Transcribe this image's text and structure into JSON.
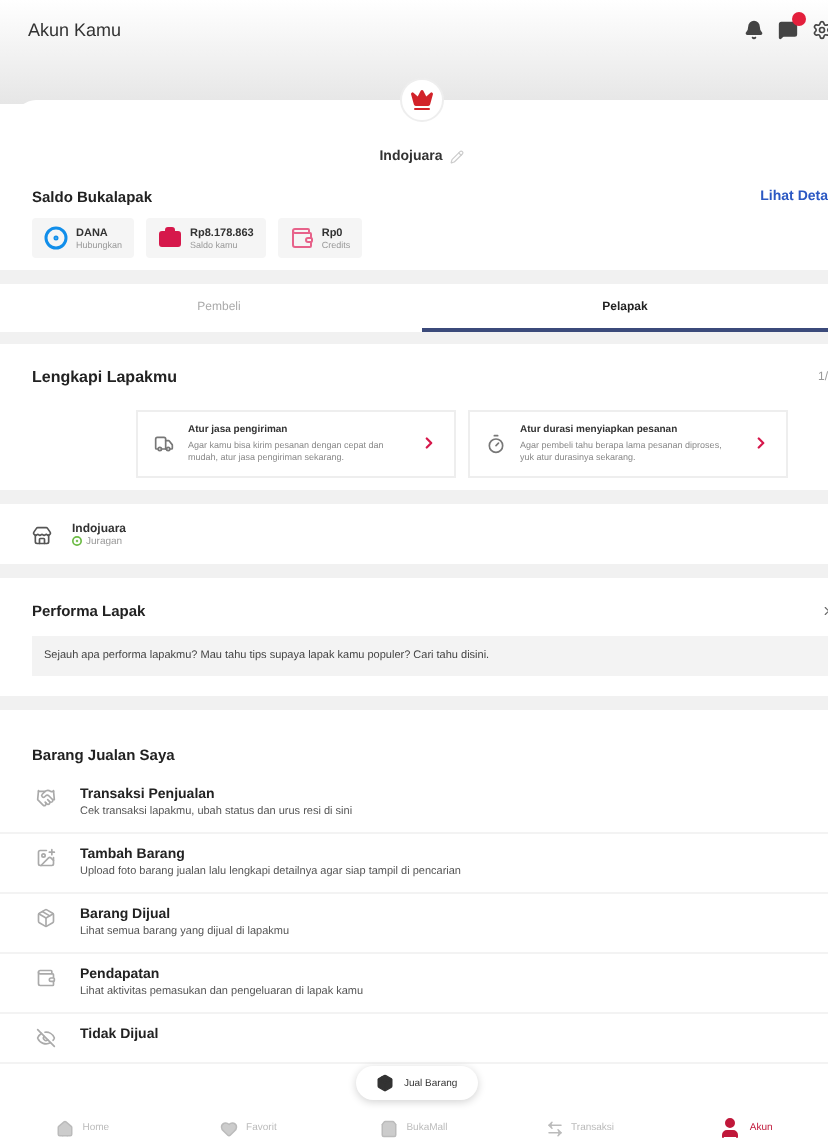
{
  "header": {
    "title": "Akun Kamu"
  },
  "profile": {
    "name": "Indojuara"
  },
  "saldo": {
    "title": "Saldo Bukalapak",
    "link": "Lihat Deta",
    "wallets": [
      {
        "kind": "dana",
        "label": "DANA",
        "sub": "Hubungkan"
      },
      {
        "kind": "saldo",
        "label": "Rp8.178.863",
        "sub": "Saldo kamu"
      },
      {
        "kind": "credits",
        "label": "Rp0",
        "sub": "Credits"
      }
    ]
  },
  "tabs": [
    {
      "label": "Pembeli",
      "selected": false
    },
    {
      "label": "Pelapak",
      "selected": true
    }
  ],
  "lengkapi": {
    "title": "Lengkapi Lapakmu",
    "progress": "1/",
    "cards": [
      {
        "kind": "shipping",
        "title": "Atur jasa pengiriman",
        "text": "Agar kamu bisa kirim pesanan dengan cepat dan mudah, atur jasa pengiriman sekarang."
      },
      {
        "kind": "timer",
        "title": "Atur durasi menyiapkan pesanan",
        "text": "Agar pembeli tahu berapa lama pesanan diproses, yuk atur durasinya sekarang."
      }
    ]
  },
  "store": {
    "name": "Indojuara",
    "level": "Juragan"
  },
  "performa": {
    "title": "Performa Lapak",
    "text": "Sejauh apa performa lapakmu? Mau tahu tips supaya lapak kamu populer? Cari tahu disini."
  },
  "barang": {
    "title": "Barang Jualan Saya",
    "items": [
      {
        "kind": "transaksi",
        "title": "Transaksi Penjualan",
        "text": "Cek transaksi lapakmu, ubah status dan urus resi di sini"
      },
      {
        "kind": "tambah",
        "title": "Tambah Barang",
        "text": "Upload foto barang jualan lalu lengkapi detailnya agar siap tampil di pencarian"
      },
      {
        "kind": "dijual",
        "title": "Barang Dijual",
        "text": "Lihat semua barang yang dijual di lapakmu"
      },
      {
        "kind": "pendapatan",
        "title": "Pendapatan",
        "text": "Lihat aktivitas pemasukan dan pengeluaran di lapak kamu"
      },
      {
        "kind": "tidak",
        "title": "Tidak Dijual"
      }
    ]
  },
  "fab": {
    "label": "Jual Barang"
  },
  "nav": [
    {
      "kind": "home",
      "label": "Home",
      "selected": false
    },
    {
      "kind": "favorit",
      "label": "Favorit",
      "selected": false
    },
    {
      "kind": "mall",
      "label": "BukaMall",
      "selected": false
    },
    {
      "kind": "transaksi",
      "label": "Transaksi",
      "selected": false
    },
    {
      "kind": "akun",
      "label": "Akun",
      "selected": true
    }
  ]
}
